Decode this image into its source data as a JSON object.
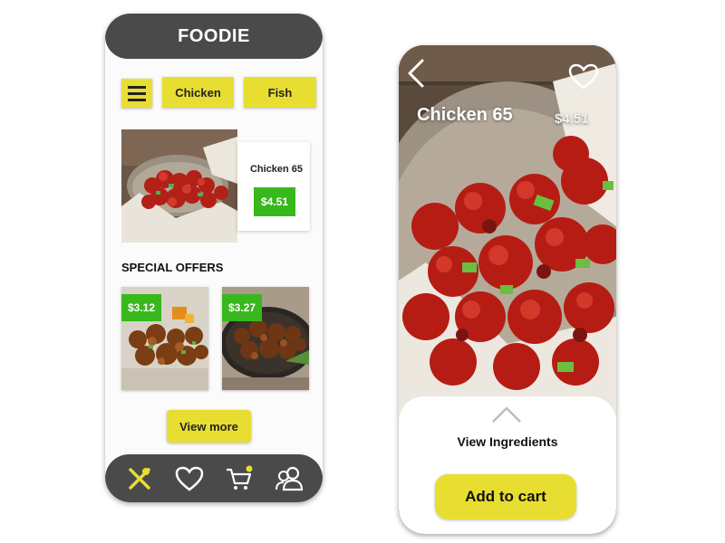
{
  "left_screen": {
    "header": {
      "title": "FOODIE"
    },
    "categories": [
      {
        "label": "Chicken"
      },
      {
        "label": "Fish"
      }
    ],
    "featured": {
      "name": "Chicken 65",
      "price": "$4.51"
    },
    "special_offers": {
      "title": "SPECIAL OFFERS",
      "items": [
        {
          "price": "$3.12"
        },
        {
          "price": "$3.27"
        }
      ]
    },
    "view_more_label": "View more",
    "bottom_nav": [
      "utensils-icon",
      "heart-icon",
      "cart-icon",
      "users-icon"
    ]
  },
  "right_screen": {
    "title": "Chicken 65",
    "price": "$4.51",
    "view_ingredients_label": "View Ingredients",
    "add_to_cart_label": "Add to cart"
  },
  "colors": {
    "accent_yellow": "#e8de32",
    "price_green": "#37b81d",
    "dark_bar": "#4a4a4a"
  }
}
